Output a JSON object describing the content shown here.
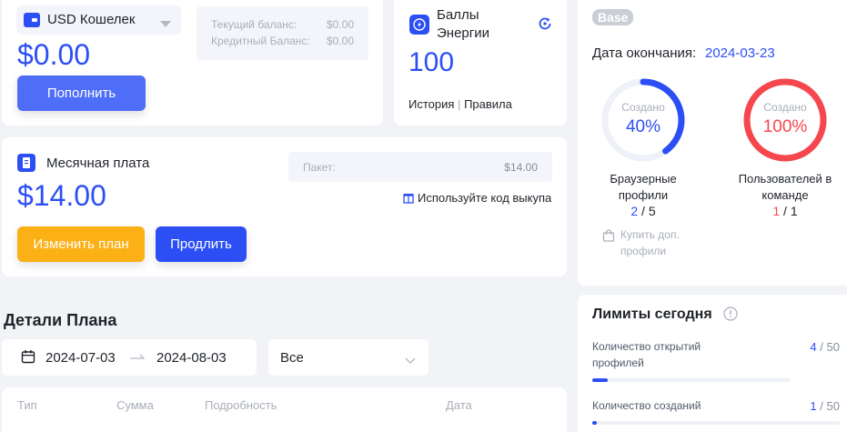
{
  "wallet": {
    "name": "USD Кошелек",
    "amount": "$0.00",
    "topup_label": "Пополнить",
    "current_balance_label": "Текущий баланс:",
    "current_balance_value": "$0.00",
    "credit_balance_label": "Кредитный Баланс:",
    "credit_balance_value": "$0.00"
  },
  "energy": {
    "title_line1": "Баллы",
    "title_line2": "Энергии",
    "value": "100",
    "history_label": "История",
    "separator": "|",
    "rules_label": "Правила"
  },
  "monthly": {
    "title": "Месячная плата",
    "amount": "$14.00",
    "package_label": "Пакет:",
    "package_value": "$14.00",
    "redeem_label": "Используйте код выкупа",
    "change_plan_label": "Изменить план",
    "renew_label": "Продлить"
  },
  "plan_details": {
    "title": "Детали Плана",
    "date_from": "2024-07-03",
    "date_to": "2024-08-03",
    "filter_value": "Все",
    "columns": [
      "Тип",
      "Сумма",
      "Подробность",
      "Дата"
    ]
  },
  "plan": {
    "badge": "Base",
    "end_label": "Дата окончания:",
    "end_date": "2024-03-23",
    "created_label": "Создано",
    "profiles": {
      "percent": "40%",
      "fraction": 0.4,
      "label_line1": "Браузерные",
      "label_line2": "профили",
      "used": "2",
      "slash": "/",
      "total": "5",
      "buy_line1": "Купить доп.",
      "buy_line2": "профили"
    },
    "members": {
      "percent": "100%",
      "fraction": 1.0,
      "label_line1": "Пользователей в",
      "label_line2": "команде",
      "used": "1",
      "slash": "/",
      "total": "1"
    }
  },
  "limits": {
    "title": "Лимиты сегодня",
    "items": [
      {
        "label_line1": "Количество открытий",
        "label_line2": "профилей",
        "used": "4",
        "slash": "/",
        "total": "50",
        "fraction": 0.08
      },
      {
        "label_line1": "Количество созданий",
        "label_line2": "",
        "used": "1",
        "slash": "/",
        "total": "50",
        "fraction": 0.02
      }
    ]
  },
  "colors": {
    "primary": "#2c4ff5",
    "primary_light": "#4f6ef7",
    "warning": "#fbb015",
    "danger": "#f5474d",
    "badge_bg": "#c9cdd4"
  }
}
